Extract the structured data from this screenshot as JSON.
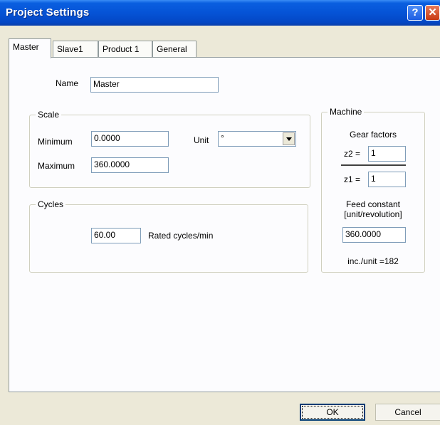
{
  "window": {
    "title": "Project Settings"
  },
  "title_buttons": {
    "help": "?",
    "close": "✕"
  },
  "tabs": [
    {
      "label": "Master",
      "active": true
    },
    {
      "label": "Slave1",
      "active": false
    },
    {
      "label": "Product 1",
      "active": false
    },
    {
      "label": "General",
      "active": false
    }
  ],
  "name": {
    "label": "Name",
    "value": "Master"
  },
  "scale": {
    "legend": "Scale",
    "minimum_label": "Minimum",
    "minimum_value": "0.0000",
    "maximum_label": "Maximum",
    "maximum_value": "360.0000",
    "unit_label": "Unit",
    "unit_value": "°"
  },
  "cycles": {
    "legend": "Cycles",
    "value": "60.00",
    "unit_label": "Rated cycles/min"
  },
  "machine": {
    "legend": "Machine",
    "gear_factors_label": "Gear factors",
    "z2_label": "z2 =",
    "z2_value": "1",
    "z1_label": "z1 =",
    "z1_value": "1",
    "feed_constant_label": "Feed constant",
    "feed_constant_unit": "[unit/revolution]",
    "feed_constant_value": "360.0000",
    "inc_per_unit": "inc./unit =182"
  },
  "buttons": {
    "ok": "OK",
    "cancel": "Cancel"
  }
}
